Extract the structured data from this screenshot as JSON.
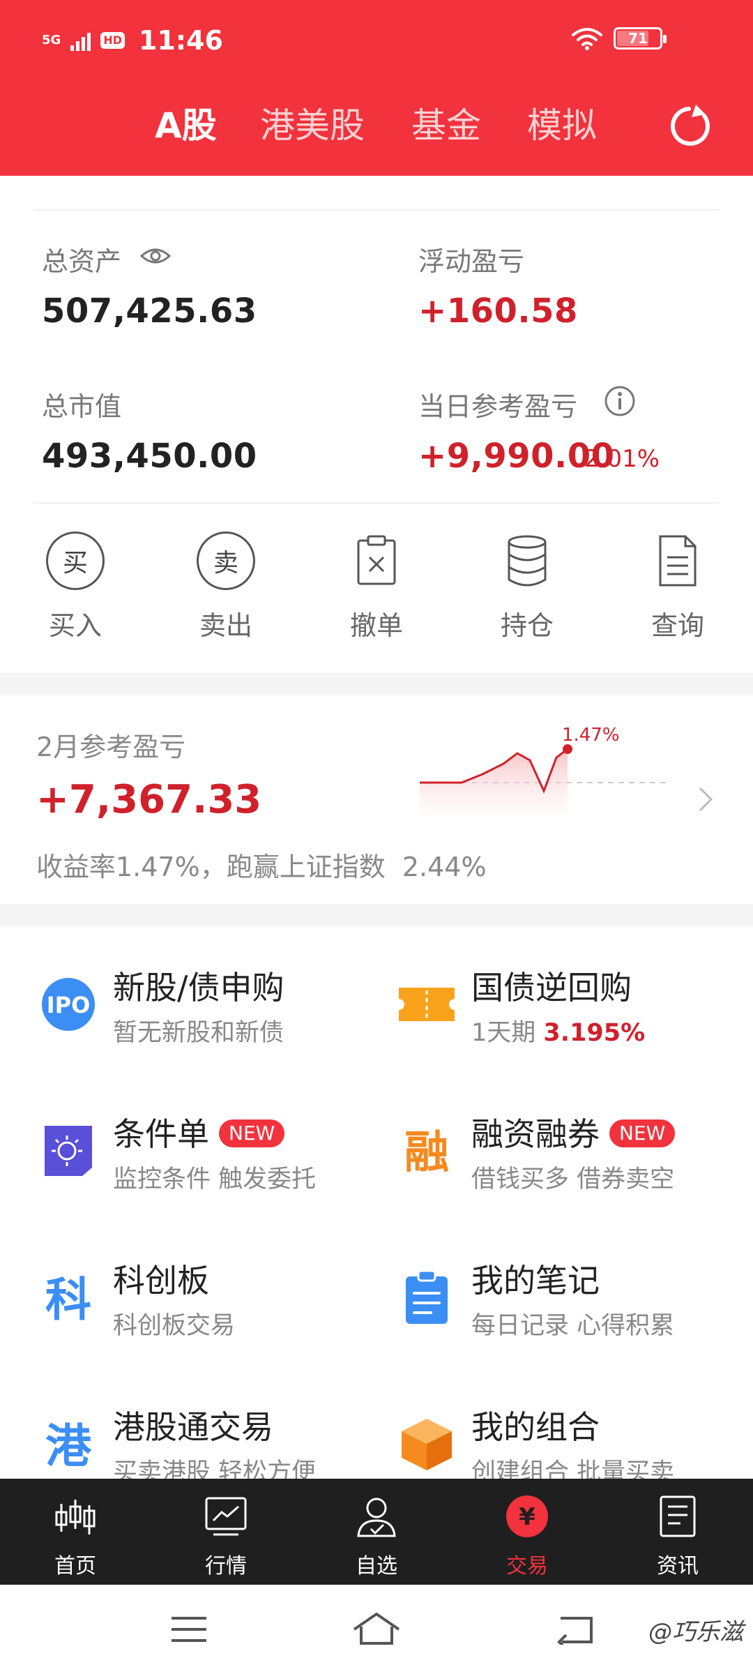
{
  "status_bar": {
    "signal": "5G",
    "hd": "HD",
    "time": "11:46",
    "battery": "71"
  },
  "tabs": [
    {
      "label": "A股",
      "active": true
    },
    {
      "label": "港美股"
    },
    {
      "label": "基金"
    },
    {
      "label": "模拟"
    }
  ],
  "account": {
    "total_assets_label": "总资产",
    "total_assets": "507,425.63",
    "floating_pl_label": "浮动盈亏",
    "floating_pl": "+160.58",
    "market_value_label": "总市值",
    "market_value": "493,450.00",
    "daily_pl_label": "当日参考盈亏",
    "daily_pl": "+9,990.00",
    "daily_pl_pct": "2.01%"
  },
  "actions": [
    {
      "label": "买入",
      "glyph": "买"
    },
    {
      "label": "卖出",
      "glyph": "卖"
    },
    {
      "label": "撤单"
    },
    {
      "label": "持仓"
    },
    {
      "label": "查询"
    }
  ],
  "monthly": {
    "title": "2月参考盈亏",
    "value": "+7,367.33",
    "subtitle": "收益率1.47%，跑赢上证指数  2.44%",
    "chart_label": "1.47%"
  },
  "services": [
    {
      "title": "新股/债申购",
      "subtitle": "暂无新股和新债",
      "icon": "ipo-icon",
      "icon_text": "IPO"
    },
    {
      "title": "国债逆回购",
      "subtitle_prefix": "1天期",
      "subtitle_rate": "3.195%",
      "icon": "ticket-icon"
    },
    {
      "title": "条件单",
      "badge": "NEW",
      "subtitle": "监控条件 触发委托",
      "icon": "condition-order-icon"
    },
    {
      "title": "融资融券",
      "badge": "NEW",
      "subtitle": "借钱买多 借券卖空",
      "icon": "margin-icon",
      "icon_text": "融"
    },
    {
      "title": "科创板",
      "subtitle": "科创板交易",
      "icon": "star-market-icon",
      "icon_text": "科"
    },
    {
      "title": "我的笔记",
      "subtitle": "每日记录 心得积累",
      "icon": "notes-icon"
    },
    {
      "title": "港股通交易",
      "subtitle": "买卖港股 轻松方便",
      "icon": "hk-connect-icon",
      "icon_text": "港"
    },
    {
      "title": "我的组合",
      "subtitle": "创建组合 批量买卖",
      "icon": "portfolio-icon"
    }
  ],
  "bottom_nav": [
    {
      "label": "首页"
    },
    {
      "label": "行情"
    },
    {
      "label": "自选"
    },
    {
      "label": "交易",
      "active": true,
      "glyph": "¥"
    },
    {
      "label": "资讯"
    }
  ],
  "watermark": "@巧乐滋",
  "colors": {
    "brand_red": "#f2323c",
    "gain_red": "#d0212b",
    "nav_dark": "#1f1f1f",
    "ipo_blue": "#3b8ef3",
    "ticket_orange": "#f8a31b",
    "condition_purple": "#5a4fd8",
    "margin_orange": "#f58a1f"
  }
}
